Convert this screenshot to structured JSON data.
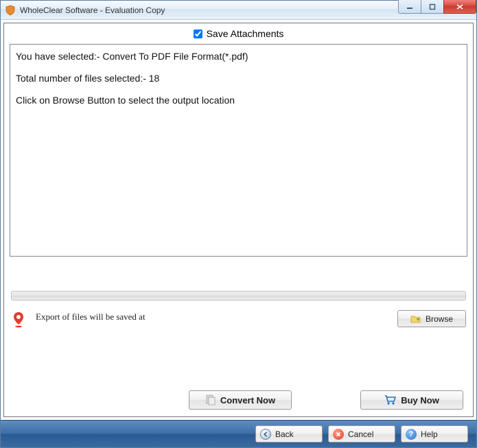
{
  "titlebar": {
    "title": "WholeClear Software - Evaluation Copy"
  },
  "checkbox": {
    "label": "Save Attachments",
    "checked": true
  },
  "info": {
    "line1": "You have selected:- Convert To PDF File Format(*.pdf)",
    "line2": "Total number of files selected:- 18",
    "line3": "Click on Browse Button to select the output location"
  },
  "export": {
    "label": "Export of files will be saved at",
    "browse": "Browse"
  },
  "actions": {
    "convert": "Convert Now",
    "buy": "Buy Now"
  },
  "footer": {
    "back": "Back",
    "cancel": "Cancel",
    "help": "Help"
  }
}
